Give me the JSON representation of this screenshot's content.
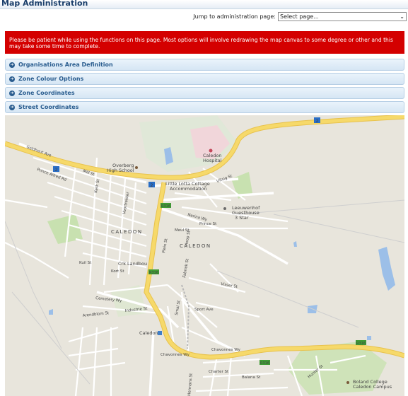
{
  "header": {
    "title": "Map Administration"
  },
  "jump": {
    "label": "Jump to administration page:",
    "selected": "Select page..."
  },
  "notice": {
    "text": "Please be patient while using the functions on this page. Most options will involve redrawing the map canvas to some degree or other and this may take some time to complete."
  },
  "panels": [
    {
      "label": "Organisations Area Definition"
    },
    {
      "label": "Zone Colour Options"
    },
    {
      "label": "Zone Coordinates"
    },
    {
      "label": "Street Coordinates"
    }
  ],
  "map": {
    "labels": {
      "overberg": "Overberg",
      "high_school": "High School",
      "little_lotta": "Little Lotta Cottage",
      "accommodation": "Accommodation",
      "caledon_hospital_1": "Caledon",
      "caledon_hospital_2": "Hospital",
      "leeuwenhof_1": "Leeuwenhof",
      "leeuwenhof_2": "Guesthouse",
      "leeuwenhof_3": "3 Star",
      "caledon_big_1": "CALEDON",
      "caledon_big_2": "CALEDON",
      "crk_landbou": "Crk Landbou",
      "caledon_station": "Caledon",
      "boland_1": "Boland College",
      "boland_2": "Caledon Campus",
      "chavonnes_1": "Chavonnes Wy",
      "chavonnes_2": "Chavonnes Wy",
      "plein_st": "Plein St",
      "hoop_st": "Hoop St",
      "prince_alfred": "Prince Alfred Rd",
      "geldhout": "Geldhout Ave",
      "industrie": "Industrie St",
      "arendblom": "Arendblom St",
      "cemetery": "Cemetery Wy",
      "meul_st": "Meul St",
      "kort_st": "Kort St",
      "kuil_st": "Kuil St",
      "sport_ave": "Sport Ave",
      "nerina": "Nerina Wy",
      "prince": "Prince St",
      "voortrekker": "Voortrekker",
      "charter": "Charter St",
      "balana": "Balana St",
      "kerk": "Kerk St",
      "hermans": "Hermans St",
      "mill": "Mill St",
      "fabriek": "Fabriek St",
      "smal": "Smal St",
      "visser": "Visser St",
      "hunter": "Hunter St",
      "uitsig": "Uitsig St"
    },
    "shields": {
      "n2": "2",
      "r316": "R316"
    },
    "colors": {
      "land": "#e8e5dc",
      "road_major": "#f6d96a",
      "park": "#c8e1b0",
      "water": "#9cbfe8"
    }
  }
}
